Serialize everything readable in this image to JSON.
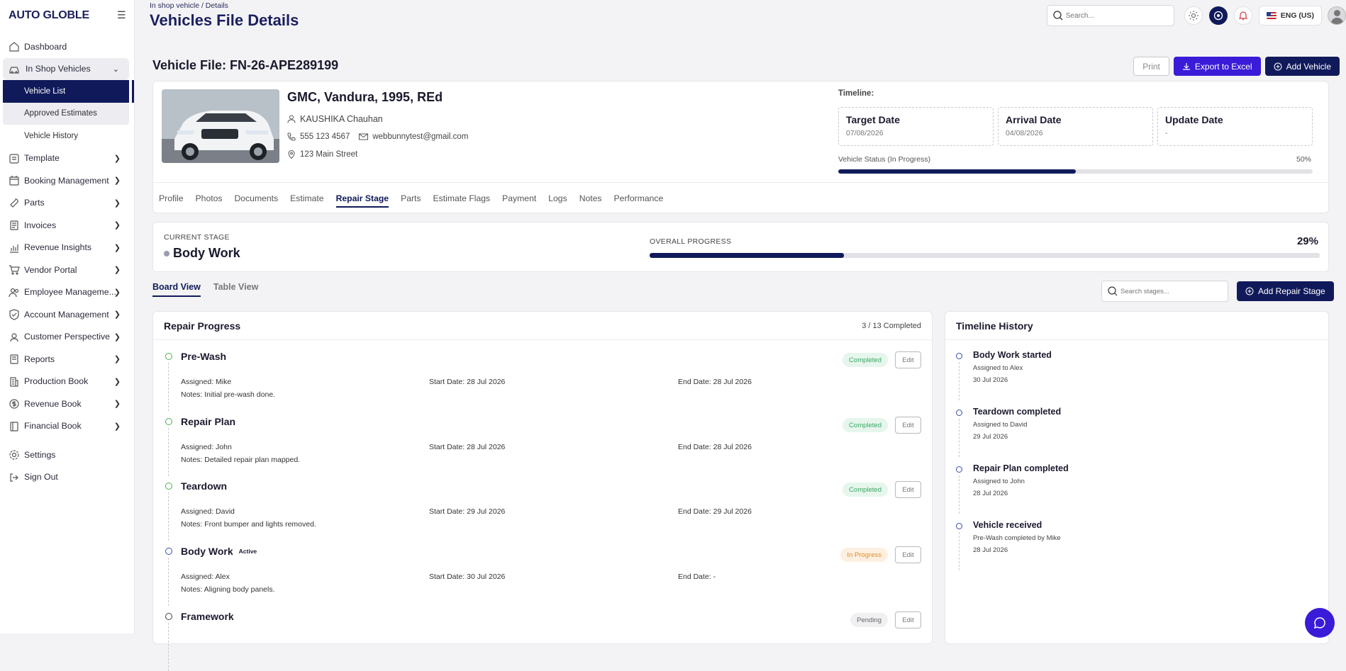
{
  "app": {
    "brand": "AUTO GLOBLE"
  },
  "sidebar": {
    "dashboard": "Dashboard",
    "in_shop": "In Shop Vehicles",
    "sub": [
      "Vehicle List",
      "Approved Estimates",
      "Vehicle History"
    ],
    "items": [
      "Template",
      "Booking Management",
      "Parts",
      "Invoices",
      "Revenue Insights",
      "Vendor Portal",
      "Employee Manageme...",
      "Account Management",
      "Customer Perspective",
      "Reports",
      "Production Book",
      "Revenue Book",
      "Financial Book"
    ],
    "settings": "Settings",
    "signout": "Sign Out"
  },
  "header": {
    "breadcrumb": "In shop vehicle / Details",
    "title": "Vehicles File Details",
    "search_placeholder": "Search...",
    "language": "ENG (US)"
  },
  "vehicle": {
    "file_title": "Vehicle File: FN-26-APE289199",
    "actions": {
      "print": "Print",
      "export": "Export to Excel",
      "add": "Add Vehicle"
    },
    "name": "GMC, Vandura, 1995, REd",
    "owner": "KAUSHIKA Chauhan",
    "phone": "555 123 4567",
    "email": "webbunnytest@gmail.com",
    "address": "123 Main Street",
    "timeline_label": "Timeline:",
    "dates": [
      {
        "title": "Target Date",
        "value": "07/08/2026"
      },
      {
        "title": "Arrival Date",
        "value": "04/08/2026"
      },
      {
        "title": "Update Date",
        "value": "-"
      }
    ],
    "status_label": "Vehicle Status (In Progress)",
    "status_pct": "50%",
    "status_fraction": 0.5
  },
  "tabs": [
    "Profile",
    "Photos",
    "Documents",
    "Estimate",
    "Repair Stage",
    "Parts",
    "Estimate Flags",
    "Payment",
    "Logs",
    "Notes",
    "Performance"
  ],
  "stage_summary": {
    "current_label": "CURRENT STAGE",
    "current": "Body Work",
    "overall_label": "OVERALL PROGRESS",
    "overall_pct": "29%",
    "overall_fraction": 0.29
  },
  "view_tabs": [
    "Board View",
    "Table View"
  ],
  "stage_search_placeholder": "Search stages...",
  "add_stage": "Add Repair Stage",
  "repair": {
    "title": "Repair Progress",
    "count": "3 / 13 Completed",
    "edit": "Edit",
    "stages": [
      {
        "name": "Pre-Wash",
        "status": "Completed",
        "assigned": "Assigned: Mike",
        "start": "Start Date: 28 Jul 2026",
        "end": "End Date: 28 Jul 2026",
        "notes": "Notes: Initial pre-wash done."
      },
      {
        "name": "Repair Plan",
        "status": "Completed",
        "assigned": "Assigned: John",
        "start": "Start Date: 28 Jul 2026",
        "end": "End Date: 28 Jul 2026",
        "notes": "Notes: Detailed repair plan mapped."
      },
      {
        "name": "Teardown",
        "status": "Completed",
        "assigned": "Assigned: David",
        "start": "Start Date: 29 Jul 2026",
        "end": "End Date: 29 Jul 2026",
        "notes": "Notes: Front bumper and lights removed."
      },
      {
        "name": "Body Work",
        "active": "Active",
        "status": "In Progress",
        "assigned": "Assigned: Alex",
        "start": "Start Date: 30 Jul 2026",
        "end": "End Date: -",
        "notes": "Notes: Aligning body panels."
      },
      {
        "name": "Framework",
        "status": "Pending"
      }
    ]
  },
  "history": {
    "title": "Timeline History",
    "items": [
      {
        "title": "Body Work started",
        "sub": "Assigned to Alex",
        "date": "30 Jul 2026"
      },
      {
        "title": "Teardown completed",
        "sub": "Assigned to David",
        "date": "29 Jul 2026"
      },
      {
        "title": "Repair Plan completed",
        "sub": "Assigned to John",
        "date": "28 Jul 2026"
      },
      {
        "title": "Vehicle received",
        "sub": "Pre-Wash completed by Mike",
        "date": "28 Jul 2026"
      }
    ]
  }
}
